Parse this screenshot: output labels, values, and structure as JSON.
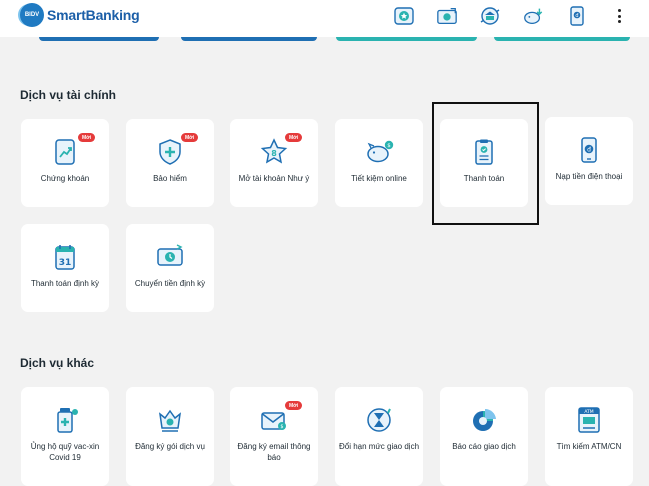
{
  "header": {
    "brand": "SmartBanking",
    "brand_badge": "BIDV",
    "icons": [
      "rewards-icon",
      "camera-transfer-icon",
      "bank-exchange-icon",
      "piggy-bank-icon",
      "phone-topup-icon",
      "more-icon"
    ]
  },
  "sections": {
    "financial": {
      "title": "Dịch vụ tài chính",
      "tiles": [
        {
          "label": "Chứng khoán",
          "badge": "Mới",
          "icon": "stock-chart-icon"
        },
        {
          "label": "Bảo hiểm",
          "badge": "Mới",
          "icon": "insurance-shield-icon"
        },
        {
          "label": "Mở tài khoản Như ý",
          "badge": "Mới",
          "icon": "star-account-icon"
        },
        {
          "label": "Tiết kiệm online",
          "badge": "",
          "icon": "piggy-bank-icon"
        },
        {
          "label": "Thanh toán",
          "badge": "",
          "icon": "bill-payment-icon"
        },
        {
          "label": "Nạp tiền điện thoại",
          "badge": "",
          "icon": "phone-topup-icon"
        },
        {
          "label": "Thanh toán định kỳ",
          "badge": "",
          "icon": "calendar-icon"
        },
        {
          "label": "Chuyển tiền định kỳ",
          "badge": "",
          "icon": "scheduled-transfer-icon"
        }
      ]
    },
    "other": {
      "title": "Dịch vụ khác",
      "tiles": [
        {
          "label": "Ủng hộ quỹ vac-xin Covid 19",
          "badge": "",
          "icon": "vaccine-icon"
        },
        {
          "label": "Đăng ký gói dịch vụ",
          "badge": "",
          "icon": "service-package-icon"
        },
        {
          "label": "Đăng ký email thông báo",
          "badge": "Mới",
          "icon": "email-notification-icon"
        },
        {
          "label": "Đổi hạn mức giao dịch",
          "badge": "",
          "icon": "limit-change-icon"
        },
        {
          "label": "Báo cáo giao dịch",
          "badge": "",
          "icon": "report-chart-icon"
        },
        {
          "label": "Tìm kiếm ATM/CN",
          "badge": "",
          "icon": "atm-icon"
        }
      ]
    }
  },
  "colors": {
    "brand_blue": "#1c5fa8",
    "icon_blue": "#1f6fb3",
    "icon_teal": "#2ab3b0",
    "badge_red": "#e53b3b",
    "background": "#f2f2f2"
  }
}
